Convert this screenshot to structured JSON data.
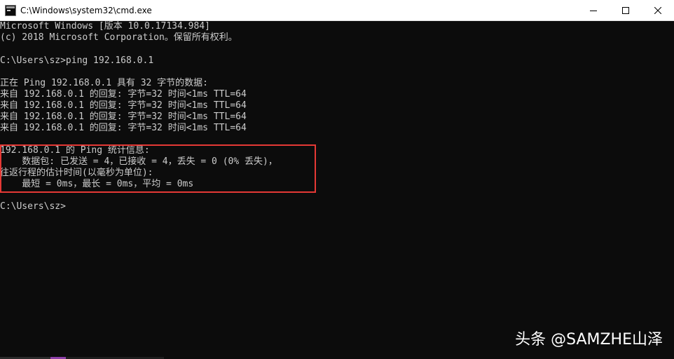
{
  "window": {
    "title": "C:\\Windows\\system32\\cmd.exe",
    "icon": "cmd-console-icon",
    "controls": [
      {
        "name": "minimize-button",
        "icon": "minimize-icon"
      },
      {
        "name": "maximize-button",
        "icon": "maximize-icon"
      },
      {
        "name": "close-button",
        "icon": "close-icon"
      }
    ]
  },
  "console": {
    "lines": [
      "Microsoft Windows [版本 10.0.17134.984]",
      "(c) 2018 Microsoft Corporation。保留所有权利。",
      "",
      "C:\\Users\\sz>ping 192.168.0.1",
      "",
      "正在 Ping 192.168.0.1 具有 32 字节的数据:",
      "来自 192.168.0.1 的回复: 字节=32 时间<1ms TTL=64",
      "来自 192.168.0.1 的回复: 字节=32 时间<1ms TTL=64",
      "来自 192.168.0.1 的回复: 字节=32 时间<1ms TTL=64",
      "来自 192.168.0.1 的回复: 字节=32 时间<1ms TTL=64",
      "",
      "192.168.0.1 的 Ping 统计信息:",
      "    数据包: 已发送 = 4，已接收 = 4，丢失 = 0 (0% 丢失)，",
      "往返行程的估计时间(以毫秒为单位):",
      "    最短 = 0ms，最长 = 0ms，平均 = 0ms",
      "",
      "C:\\Users\\sz>"
    ]
  },
  "watermark": {
    "text": "头条 @SAMZHE山泽"
  },
  "colors": {
    "console_background": "#0c0c0c",
    "console_text": "#cccccc",
    "highlight_border": "#e53935",
    "titlebar_background": "#ffffff"
  }
}
